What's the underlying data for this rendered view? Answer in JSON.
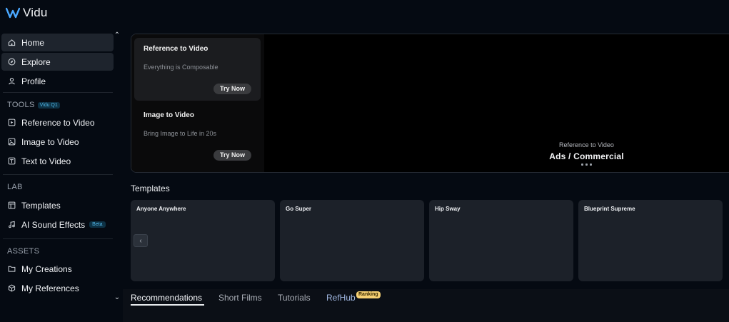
{
  "app": {
    "name": "Vidu"
  },
  "sidebar": {
    "top_items": [
      {
        "label": "Home",
        "icon": "home-icon"
      },
      {
        "label": "Explore",
        "icon": "compass-icon"
      },
      {
        "label": "Profile",
        "icon": "user-icon"
      }
    ],
    "tools": {
      "label": "TOOLS",
      "badge": "Vidu Q1",
      "items": [
        {
          "label": "Reference to Video",
          "icon": "reference-video-icon"
        },
        {
          "label": "Image to Video",
          "icon": "image-video-icon"
        },
        {
          "label": "Text to Video",
          "icon": "text-video-icon"
        }
      ]
    },
    "lab": {
      "label": "LAB",
      "items": [
        {
          "label": "Templates",
          "icon": "templates-icon"
        },
        {
          "label": "AI Sound Effects",
          "icon": "music-icon",
          "badge": "Beta"
        }
      ]
    },
    "assets": {
      "label": "ASSETS",
      "items": [
        {
          "label": "My Creations",
          "icon": "folder-icon"
        },
        {
          "label": "My References",
          "icon": "cube-icon"
        }
      ]
    }
  },
  "hero": {
    "cards": [
      {
        "title": "Reference to Video",
        "subtitle": "Everything is Composable",
        "button": "Try Now"
      },
      {
        "title": "Image to Video",
        "subtitle": "Bring Image to Life in 20s",
        "button": "Try Now"
      }
    ],
    "caption_small": "Reference to Video",
    "caption_big": "Ads / Commercial"
  },
  "templates": {
    "title": "Templates",
    "cards": [
      "Anyone Anywhere",
      "Go Super",
      "Hip Sway",
      "Blueprint Supreme"
    ]
  },
  "tabs": {
    "items": [
      "Recommendations",
      "Short Films",
      "Tutorials",
      "RefHub"
    ],
    "ranking_badge": "Ranking"
  },
  "colors": {
    "accent": "#51b6e6",
    "badge_gold": "#f6d073",
    "background": "#050a12"
  }
}
